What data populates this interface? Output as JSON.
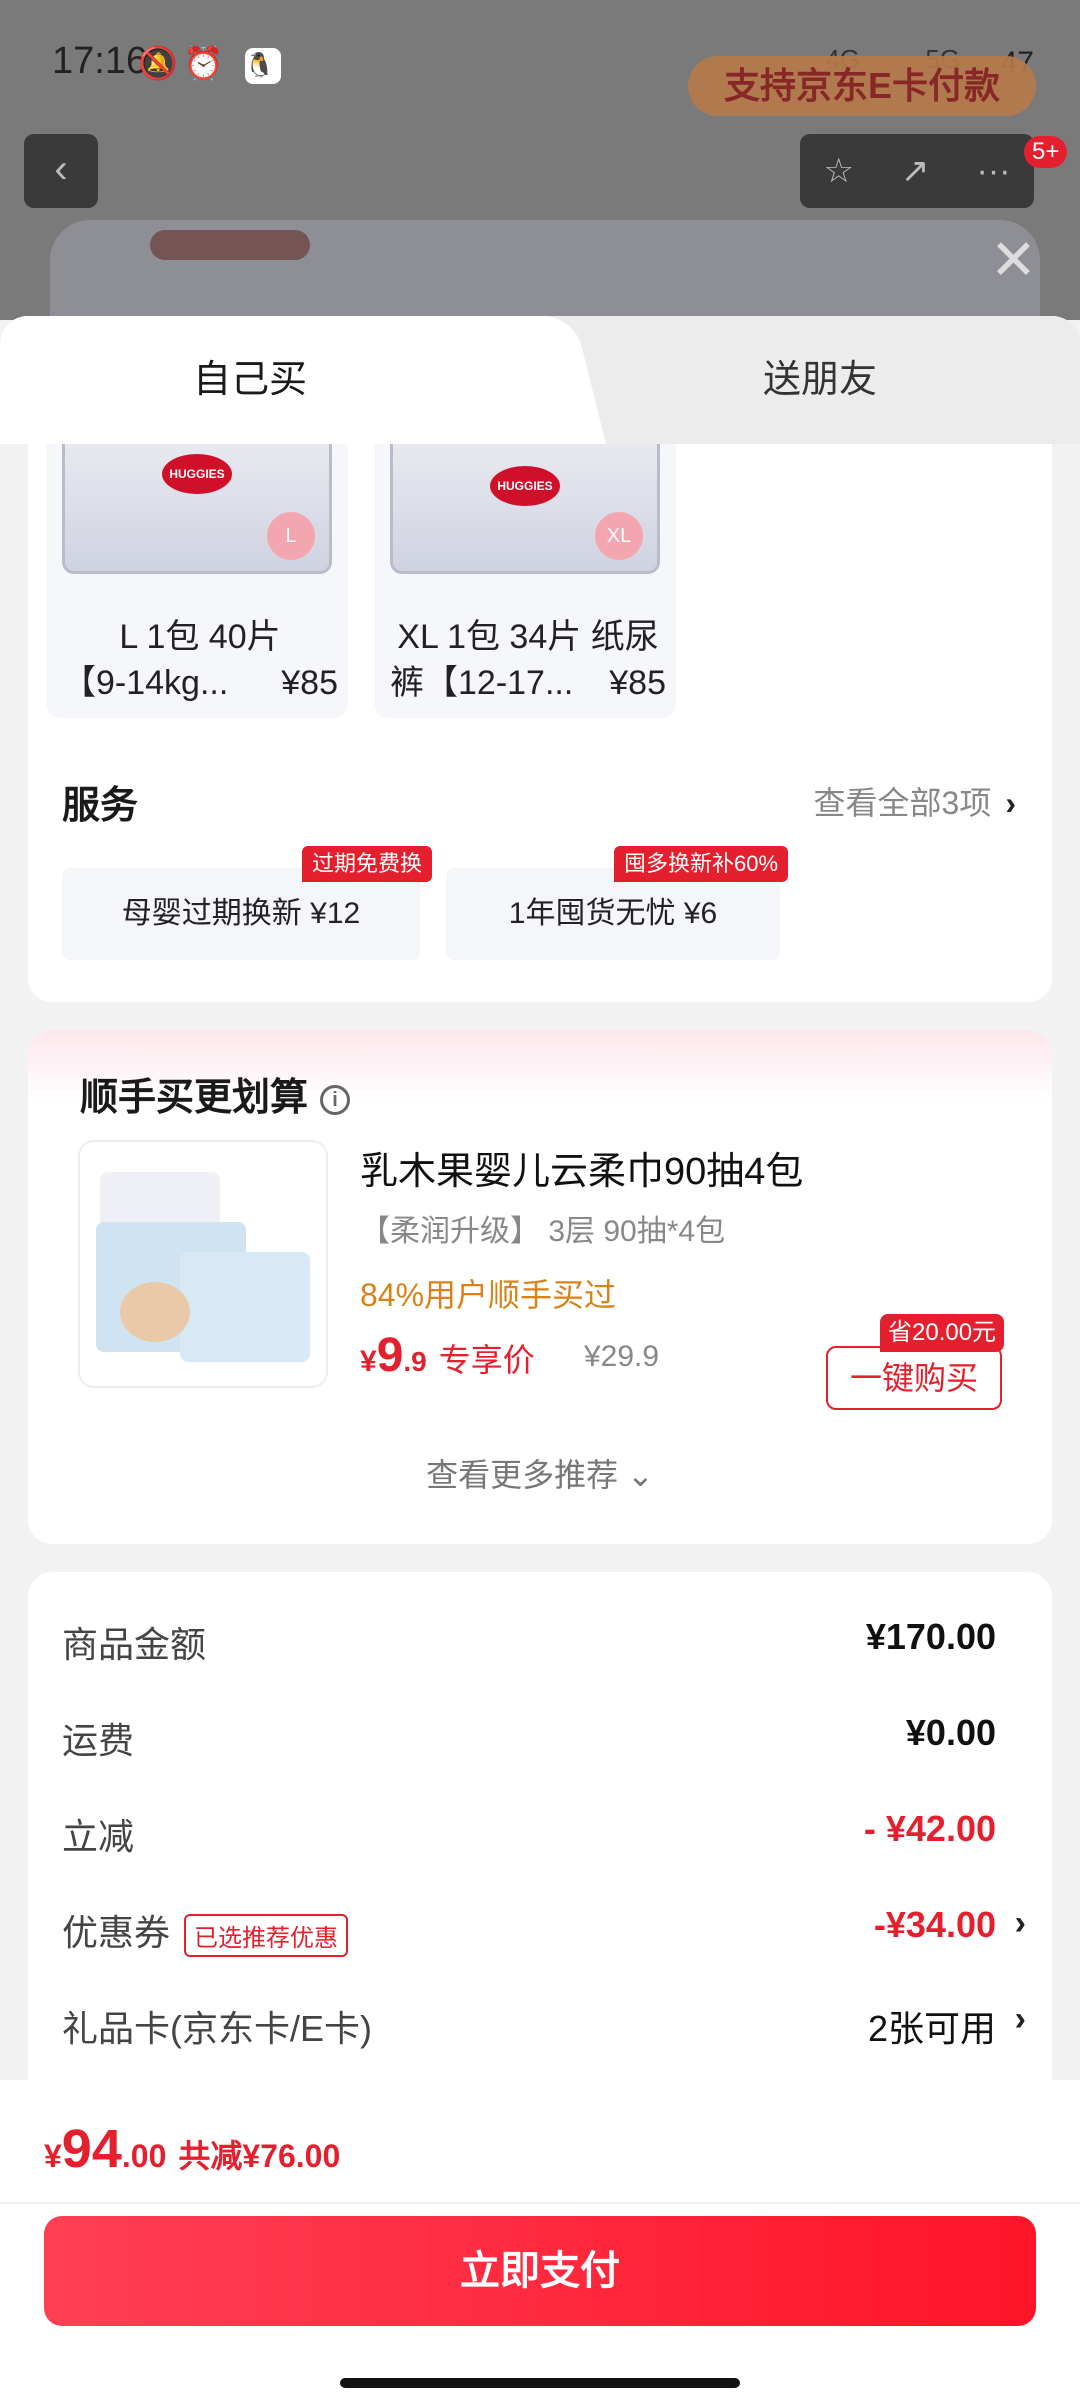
{
  "status": {
    "time": "17:16",
    "network_1": "4G",
    "network_2": "5G",
    "battery": "47"
  },
  "background": {
    "ecard_banner": "支持京东E卡付款",
    "badge": "5+"
  },
  "tabs": [
    {
      "label": "自己买",
      "active": true
    },
    {
      "label": "送朋友",
      "active": false
    }
  ],
  "skus": [
    {
      "size": "L",
      "line1": "L 1包 40片",
      "line2": "【9-14kg...",
      "price": "¥85"
    },
    {
      "size": "XL",
      "line1": "XL 1包 34片 纸尿",
      "line2": "裤【12-17...",
      "price": "¥85"
    }
  ],
  "service": {
    "title": "服务",
    "more": "查看全部3项",
    "items": [
      {
        "label": "母婴过期换新  ¥12",
        "tag": "过期免费换"
      },
      {
        "label": "1年囤货无忧  ¥6",
        "tag": "囤多换新补60%"
      }
    ]
  },
  "recommend": {
    "title": "顺手买更划算",
    "name": "乳木果婴儿云柔巾90抽4包",
    "subtitle": "【柔润升级】 3层 90抽*4包",
    "rate": "84%用户顺手买过",
    "price_yen": "¥",
    "price_int": "9",
    "price_dec": ".9",
    "price_label": "专享价",
    "orig_price": "¥29.9",
    "save_tag": "省20.00元",
    "buy_button": "一键购买",
    "see_more": "查看更多推荐"
  },
  "summary": {
    "goods_label": "商品金额",
    "goods_value": "¥170.00",
    "ship_label": "运费",
    "ship_value": "¥0.00",
    "discount_label": "立减",
    "discount_value": "- ¥42.00",
    "coupon_label": "优惠券",
    "coupon_tag": "已选推荐优惠",
    "coupon_value": "-¥34.00",
    "gift_label": "礼品卡(京东卡/E卡)",
    "gift_value": "2张可用"
  },
  "footer": {
    "yen": "¥",
    "total_int": "94",
    "total_dec": ".00",
    "saved": "共减¥76.00",
    "pay_button": "立即支付"
  },
  "colors": {
    "accent": "#e5202e",
    "orange": "#d98218"
  }
}
